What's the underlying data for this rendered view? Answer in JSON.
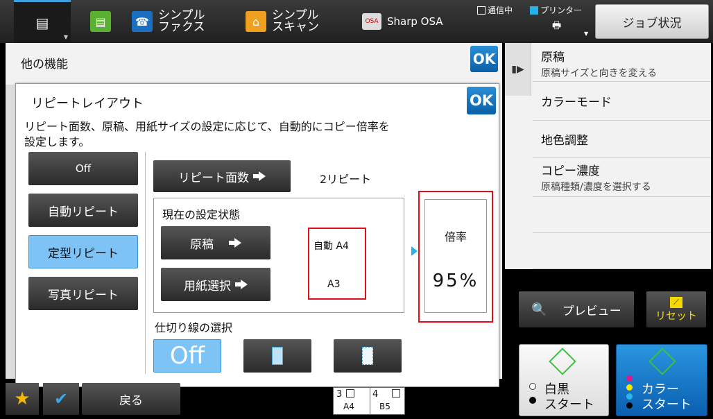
{
  "topbar": {
    "app1_label": "シンプル\nファクス",
    "app2_label": "シンプル\nスキャン",
    "app3_label": "Sharp OSA",
    "status_comm": "通信中",
    "status_printer": "プリンター",
    "job_status": "ジョブ状況"
  },
  "background": {
    "title": "他の機能",
    "ok": "OK"
  },
  "rightmenu": {
    "items": [
      {
        "title": "原稿",
        "sub": "原稿サイズと向きを変える"
      },
      {
        "title": "カラーモード",
        "sub": ""
      },
      {
        "title": "地色調整",
        "sub": ""
      },
      {
        "title": "コピー濃度",
        "sub": "原稿種類/濃度を選択する"
      }
    ]
  },
  "dialog": {
    "title": "リピートレイアウト",
    "description_line1": "リピート面数、原稿、用紙サイズの設定に応じて、自動的にコピー倍率を",
    "description_line2": "設定します。",
    "ok": "OK",
    "modes": [
      "Off",
      "自動リピート",
      "定型リピート",
      "写真リピート"
    ],
    "selected_mode": "定型リピート",
    "repeat_count_button": "リピート面数",
    "repeat_count_value": "2リピート",
    "current_settings_label": "現在の設定状態",
    "original_button": "原稿",
    "original_value": "自動 A4",
    "paper_button": "用紙選択",
    "paper_value": "A3",
    "ratio_label": "倍率",
    "ratio_value": "95%",
    "divider_label": "仕切り線の選択",
    "divider_off": "Off"
  },
  "bottom": {
    "back": "戻る",
    "preview": "プレビュー",
    "reset": "リセット",
    "bw_start_line1": "白黒",
    "bw_start_line2": "スタート",
    "color_start_line1": "カラー",
    "color_start_line2": "スタート",
    "tray1_num": "3",
    "tray1_size": "A4",
    "tray2_num": "4",
    "tray2_size": "B5"
  },
  "colors": {
    "accent_blue": "#0b5fa6",
    "selected_blue": "#7ec3f5",
    "highlight_red": "#e0101a"
  }
}
